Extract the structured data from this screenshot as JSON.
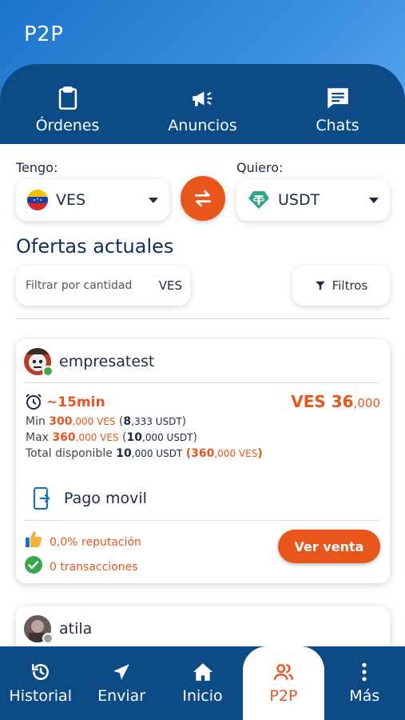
{
  "app": {
    "title": "P2P"
  },
  "tabs": [
    {
      "label": "Órdenes",
      "icon": "clipboard-icon"
    },
    {
      "label": "Anuncios",
      "icon": "megaphone-icon"
    },
    {
      "label": "Chats",
      "icon": "chat-icon"
    }
  ],
  "exchange": {
    "have_label": "Tengo:",
    "have_value": "VES",
    "want_label": "Quiero:",
    "want_value": "USDT"
  },
  "offers": {
    "title": "Ofertas actuales",
    "amount_placeholder": "Filtrar por cantidad",
    "amount_currency": "VES",
    "filters_label": "Filtros"
  },
  "cards": [
    {
      "user": "empresatest",
      "time": "~15min",
      "price_currency": "VES",
      "price_main": "36",
      "price_decimals": ",000",
      "min_label": "Min",
      "min_main": "300",
      "min_dec": ",000 VES",
      "min_conv_open": "(",
      "min_conv_main": "8",
      "min_conv_dec": ",333 USDT",
      "min_conv_close": ")",
      "max_label": "Max",
      "max_main": "360",
      "max_dec": ",000 VES",
      "max_conv_open": "(",
      "max_conv_main": "10",
      "max_conv_dec": ",000 USDT",
      "max_conv_close": ")",
      "total_label": "Total disponible",
      "total_main": "10",
      "total_dec": ",000 USDT",
      "total_conv_open": "(",
      "total_conv_main": "360",
      "total_conv_dec": ",000 VES",
      "total_conv_close": ")",
      "payment": "Pago movil",
      "reputation": "0,0% reputación",
      "transactions": "0 transacciones",
      "cta": "Ver venta"
    },
    {
      "user": "atila"
    }
  ],
  "bottom_nav": [
    {
      "label": "Historial",
      "icon": "history-icon"
    },
    {
      "label": "Enviar",
      "icon": "send-icon"
    },
    {
      "label": "Inicio",
      "icon": "home-icon"
    },
    {
      "label": "P2P",
      "icon": "users-icon",
      "active": true
    },
    {
      "label": "Más",
      "icon": "more-vertical-icon"
    }
  ],
  "colors": {
    "primary": "#0d4b86",
    "accent": "#e8561c",
    "hero": "#3a8fe0"
  }
}
